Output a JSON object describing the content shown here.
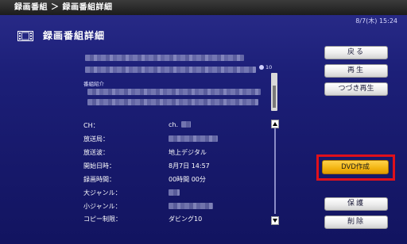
{
  "header": {
    "breadcrumb": "録画番組 ＞ 録画番組詳細",
    "datetime": "8/7(木)  15:24"
  },
  "title": {
    "label": "録画番組詳細",
    "icon": "film-icon"
  },
  "top_panel": {
    "count_label": "10",
    "description_label": "番組紹介"
  },
  "details": {
    "rows": [
      {
        "label": "CH：",
        "value": "ch."
      },
      {
        "label": "放送局：",
        "value": ""
      },
      {
        "label": "放送波：",
        "value": "地上デジタル"
      },
      {
        "label": "開始日時：",
        "value": "8月7日  14:57"
      },
      {
        "label": "録画時間：",
        "value": "00時間  00分"
      },
      {
        "label": "大ジャンル：",
        "value": ""
      },
      {
        "label": "小ジャンル：",
        "value": ""
      },
      {
        "label": "コピー制限：",
        "value": "ダビング10"
      }
    ]
  },
  "buttons": {
    "back": "戻る",
    "play": "再生",
    "resume": "つづき再生",
    "dvd": "DVD作成",
    "protect": "保護",
    "delete": "削除"
  },
  "colors": {
    "highlight_border": "#e0101b",
    "dvd_button": "#f2b410"
  }
}
